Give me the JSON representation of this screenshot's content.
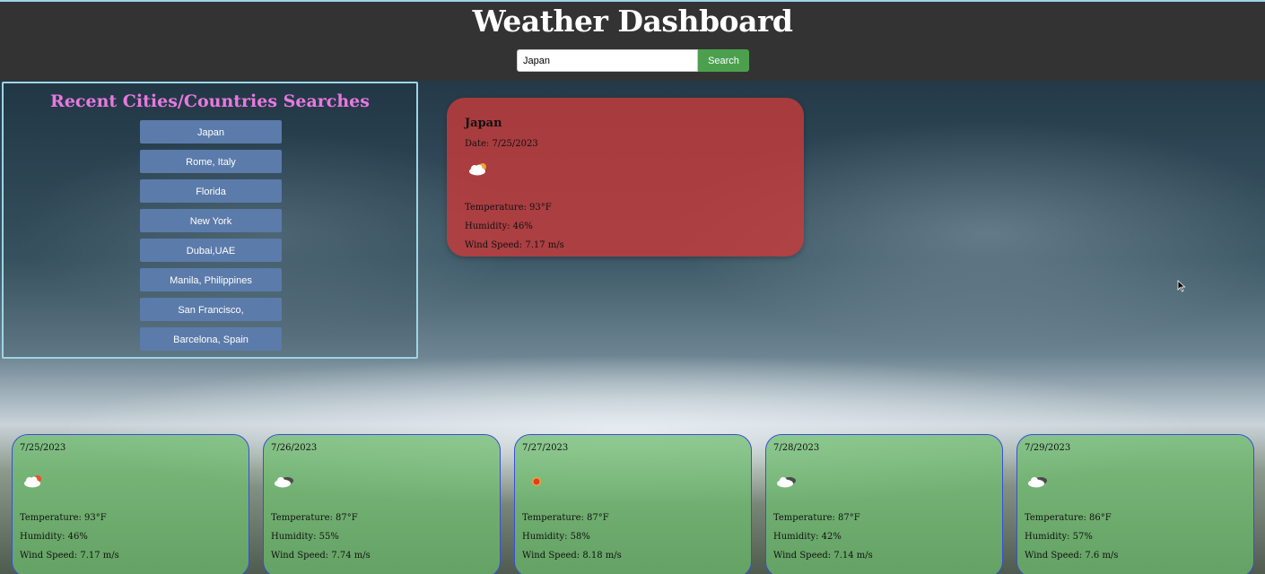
{
  "header": {
    "title": "Weather Dashboard",
    "search_value": "Japan",
    "search_button": "Search"
  },
  "recent": {
    "title": "Recent Cities/Countries Searches",
    "items": [
      "Japan",
      "Rome, Italy",
      "Florida",
      "New York",
      "Dubai,UAE",
      "Manila, Philippines",
      "San Francisco,",
      "Barcelona, Spain"
    ]
  },
  "current": {
    "city": "Japan",
    "date": "Date: 7/25/2023",
    "icon": "cloud-sun-icon",
    "temperature": "Temperature: 93°F",
    "humidity": "Humidity: 46%",
    "wind": "Wind Speed: 7.17 m/s"
  },
  "forecast": [
    {
      "date": "7/25/2023",
      "icon": "cloud-sun-icon",
      "temperature": "Temperature: 93°F",
      "humidity": "Humidity: 46%",
      "wind": "Wind Speed: 7.17 m/s"
    },
    {
      "date": "7/26/2023",
      "icon": "cloud-dark-icon",
      "temperature": "Temperature: 87°F",
      "humidity": "Humidity: 55%",
      "wind": "Wind Speed: 7.74 m/s"
    },
    {
      "date": "7/27/2023",
      "icon": "sun-icon",
      "temperature": "Temperature: 87°F",
      "humidity": "Humidity: 58%",
      "wind": "Wind Speed: 8.18 m/s"
    },
    {
      "date": "7/28/2023",
      "icon": "cloud-dark-icon",
      "temperature": "Temperature: 87°F",
      "humidity": "Humidity: 42%",
      "wind": "Wind Speed: 7.14 m/s"
    },
    {
      "date": "7/29/2023",
      "icon": "cloud-dark-icon",
      "temperature": "Temperature: 86°F",
      "humidity": "Humidity: 57%",
      "wind": "Wind Speed: 7.6 m/s"
    }
  ],
  "colors": {
    "topbar": "#333333",
    "search_button": "#4ca04d",
    "recent_title": "#e879e0",
    "recent_item": "#5b7bab",
    "current_card": "#c43a3a",
    "forecast_card": "#6ebe6e",
    "forecast_border": "#3a4fd6"
  }
}
